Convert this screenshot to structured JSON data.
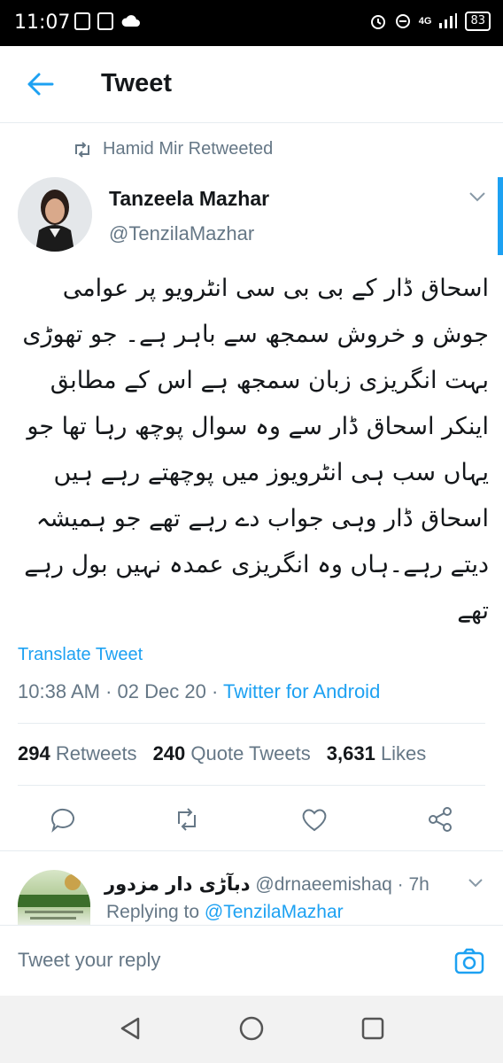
{
  "status_bar": {
    "time": "11:07",
    "network": "4G",
    "battery": "83"
  },
  "header": {
    "title": "Tweet"
  },
  "retweet": {
    "label": "Hamid Mir Retweeted"
  },
  "tweet": {
    "author_name": "Tanzeela Mazhar",
    "author_handle": "@TenzilaMazhar",
    "text": "اسحاق ڈار کے بی بی سی انٹرویو پر عوامی جوش و خروش سمجھ سے باہر ہے۔ جو تھوڑی بہت انگریزی زبان سمجھ ہے اس کے مطابق اینکر اسحاق ڈار سے وہ سوال پوچھ رہا تھا جو یہاں سب ہی انٹرویوز میں پوچھتے رہے ہیں اسحاق ڈار وہی جواب دے رہے تھے جو ہمیشہ دیتے رہے۔ہاں وہ انگریزی عمدہ نہیں بول رہے تھے",
    "translate_label": "Translate Tweet",
    "time": "10:38 AM",
    "date": "02 Dec 20",
    "source": "Twitter for Android",
    "retweets_count": "294",
    "retweets_label": "Retweets",
    "quotes_count": "240",
    "quotes_label": "Quote Tweets",
    "likes_count": "3,631",
    "likes_label": "Likes"
  },
  "reply": {
    "name": "دبآڑی دار مزدور",
    "handle": "@drnaeemishaq",
    "time": "7h",
    "replying_prefix": "Replying to",
    "replying_to": "@TenzilaMazhar"
  },
  "composer": {
    "placeholder": "Tweet your reply"
  },
  "colors": {
    "accent": "#1da1f2",
    "muted": "#657786",
    "text": "#14171a"
  },
  "icons": [
    "back-arrow-icon",
    "retweet-icon",
    "chevron-down-icon",
    "reply-icon",
    "retweet-icon",
    "like-icon",
    "share-icon",
    "camera-icon",
    "nav-back-icon",
    "nav-home-icon",
    "nav-recents-icon"
  ]
}
